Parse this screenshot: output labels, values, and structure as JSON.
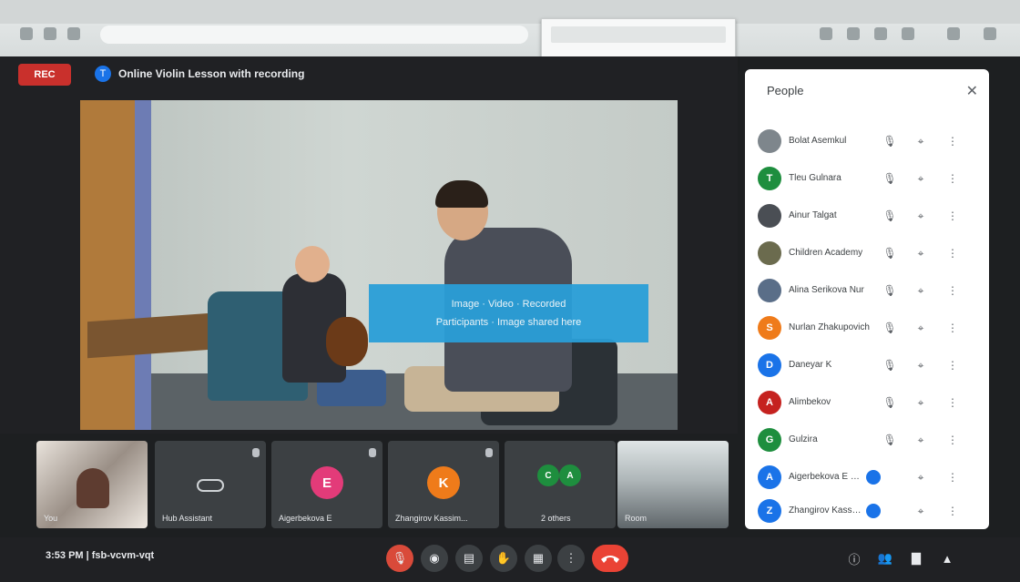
{
  "colors": {
    "record": "#c9302c",
    "accent": "#1a73e8",
    "leave": "#ea4335",
    "notice": "#2a9fd8",
    "panel_bg": "#ffffff",
    "bar_bg": "#202124"
  },
  "header": {
    "rec_label": "REC",
    "meeting_icon_letter": "T",
    "meeting_title": "Online Violin Lesson with recording"
  },
  "notice": {
    "line1": "Image · Video · Recorded",
    "line2": "Participants · Image shared here"
  },
  "tiles": [
    {
      "name": "You",
      "kind": "self",
      "muted": false
    },
    {
      "name": "Hub Assistant",
      "kind": "hub",
      "muted": true
    },
    {
      "name": "Aigerbekova E",
      "kind": "avatar",
      "letter": "E",
      "color": "#e33b79",
      "muted": true
    },
    {
      "name": "Zhangirov Kassim...",
      "kind": "avatar",
      "letter": "K",
      "color": "#ef7b1a",
      "muted": true
    },
    {
      "name": "2 others",
      "kind": "group",
      "letters": [
        "C",
        "A"
      ],
      "color": "#1e8e3e",
      "muted": true
    },
    {
      "name": "Room",
      "kind": "room",
      "muted": false
    }
  ],
  "bottom_bar": {
    "time_label": "3:53 PM  |  fsb-vcvm-vqt",
    "controls": [
      {
        "icon": "mic-off-icon",
        "glyph": "🎙"
      },
      {
        "icon": "camera-icon",
        "glyph": "◉"
      },
      {
        "icon": "captions-icon",
        "glyph": "▤"
      },
      {
        "icon": "raise-hand-icon",
        "glyph": "✋"
      },
      {
        "icon": "present-icon",
        "glyph": "▦"
      },
      {
        "icon": "more-options-icon",
        "glyph": "⋮"
      }
    ],
    "right_controls": [
      {
        "icon": "info-icon",
        "glyph": "ⓘ"
      },
      {
        "icon": "people-icon",
        "glyph": "👥"
      },
      {
        "icon": "chat-icon",
        "glyph": "▇"
      },
      {
        "icon": "activities-icon",
        "glyph": "▲"
      }
    ]
  },
  "people_panel": {
    "title": "People",
    "participants": [
      {
        "name": "Bolat Asemkul",
        "letter": "",
        "color": "#7e868c"
      },
      {
        "name": "Tleu Gulnara",
        "letter": "T",
        "color": "#1e8e3e"
      },
      {
        "name": "Ainur Talgat",
        "letter": "",
        "color": "#4a4e54"
      },
      {
        "name": "Children Academy",
        "letter": "",
        "color": "#6b6b4e"
      },
      {
        "name": "Alina Serikova Nur",
        "letter": "",
        "color": "#5a6e88"
      },
      {
        "name": "Nurlan Zhakupovich",
        "letter": "S",
        "color": "#ef7b1a"
      },
      {
        "name": "Daneyar K",
        "letter": "D",
        "color": "#1a73e8"
      },
      {
        "name": "Alimbekov",
        "letter": "A",
        "color": "#c5221f"
      },
      {
        "name": "Gulzira",
        "letter": "G",
        "color": "#1e8e3e"
      },
      {
        "name": "Aigerbekova E (Presentation)",
        "letter": "A",
        "color": "#1a73e8"
      },
      {
        "name": "Zhangirov Kassim (Presentation)",
        "letter": "Z",
        "color": "#1a73e8"
      }
    ]
  },
  "browser": {
    "menu_items": [
      "",
      ""
    ]
  }
}
